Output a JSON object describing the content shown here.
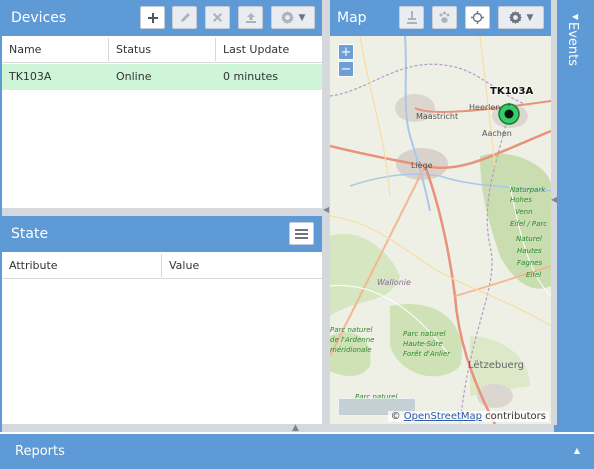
{
  "devices": {
    "title": "Devices",
    "columns": [
      "Name",
      "Status",
      "Last Update"
    ],
    "rows": [
      {
        "name": "TK103A",
        "status": "Online",
        "last_update": "0 minutes"
      }
    ],
    "toolbar": {
      "add_icon": "plus-icon",
      "edit_icon": "pencil-icon",
      "remove_icon": "close-icon",
      "command_icon": "upload-icon",
      "settings_icon": "gear-icon"
    },
    "selected_row_color": "#cff5d8"
  },
  "state": {
    "title": "State",
    "columns": [
      "Attribute",
      "Value"
    ]
  },
  "map": {
    "title": "Map",
    "zoom_in": "+",
    "zoom_out": "−",
    "device_label": "TK103A",
    "attribution_prefix": "©",
    "attribution_link": "OpenStreetMap",
    "attribution_suffix": " contributors",
    "places": [
      "Heerlen",
      "Maastricht",
      "Aachen",
      "Liège",
      "Wallonie",
      "Parc naturel Haute-Sûre Forêt d'Anlier",
      "Parc naturel de l'Ardenne méridionale",
      "Lëtzebuerg",
      "Naturpark Hohes Venn Eifel / Parc Naturel Hautes Fagnes Eifel",
      "Parc naturel"
    ]
  },
  "events": {
    "title": "Events"
  },
  "reports": {
    "title": "Reports"
  },
  "colors": {
    "header_blue": "#5d9ad6",
    "online_green": "#cff5d8"
  }
}
